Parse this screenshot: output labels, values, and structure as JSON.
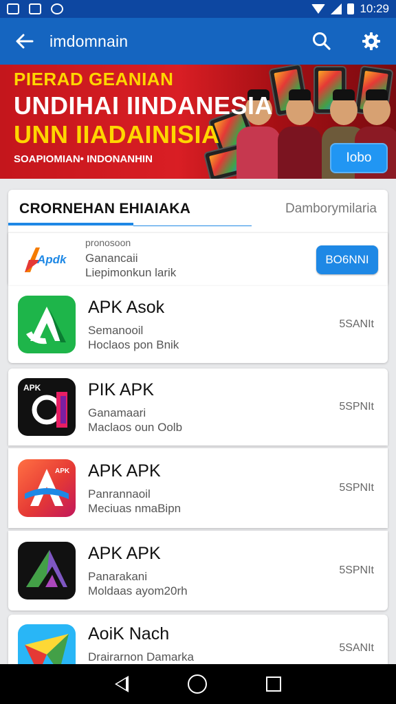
{
  "status_bar": {
    "time": "10:29"
  },
  "app_bar": {
    "title": "imdomnain"
  },
  "banner": {
    "line1": "PIERAD GEANIAN",
    "line2": "UNDIHAI IINDANESIA",
    "line3": "UNN IIADAINISIA",
    "line4": "SOAPIOMIAN• INDONANHIN",
    "button_label": "Iobo"
  },
  "tabs": {
    "left": "CRORNEHAN EHIAIAKA",
    "right": "Damborymilaria"
  },
  "first_item": {
    "overline": "pronosoon",
    "sub1": "Ganancaii",
    "sub2": "Liepimonkun larik",
    "button_label": "BO6NNI",
    "icon_text": "Apdk"
  },
  "apps": [
    {
      "name": "APK Asok",
      "sub1": "Semanooil",
      "sub2": "Hoclaos pon Bnik",
      "size": "5SANIt",
      "icon": "apk-green-icon"
    },
    {
      "name": "PIK APK",
      "sub1": "Ganamaari",
      "sub2": "Maclaos oun Oolb",
      "size": "5SPNIt",
      "icon": "apk-dark-icon"
    },
    {
      "name": "APK APK",
      "sub1": "Panrannaoil",
      "sub2": "Meciuas nmaBipn",
      "size": "5SPNIt",
      "icon": "apk-red-icon"
    },
    {
      "name": "APK APK",
      "sub1": "Panarakani",
      "sub2": "Moldaas ayom20rh",
      "size": "5SPNIt",
      "icon": "apk-purple-icon"
    },
    {
      "name": "AoiK Nach",
      "sub1": "Drairarnon Damarka",
      "sub2": "",
      "size": "5SANIt",
      "icon": "apk-colorful-icon"
    }
  ],
  "colors": {
    "app_bar": "#1565c0",
    "status_bar": "#0d47a1",
    "accent": "#1e88e5",
    "banner": "#d91e24"
  }
}
